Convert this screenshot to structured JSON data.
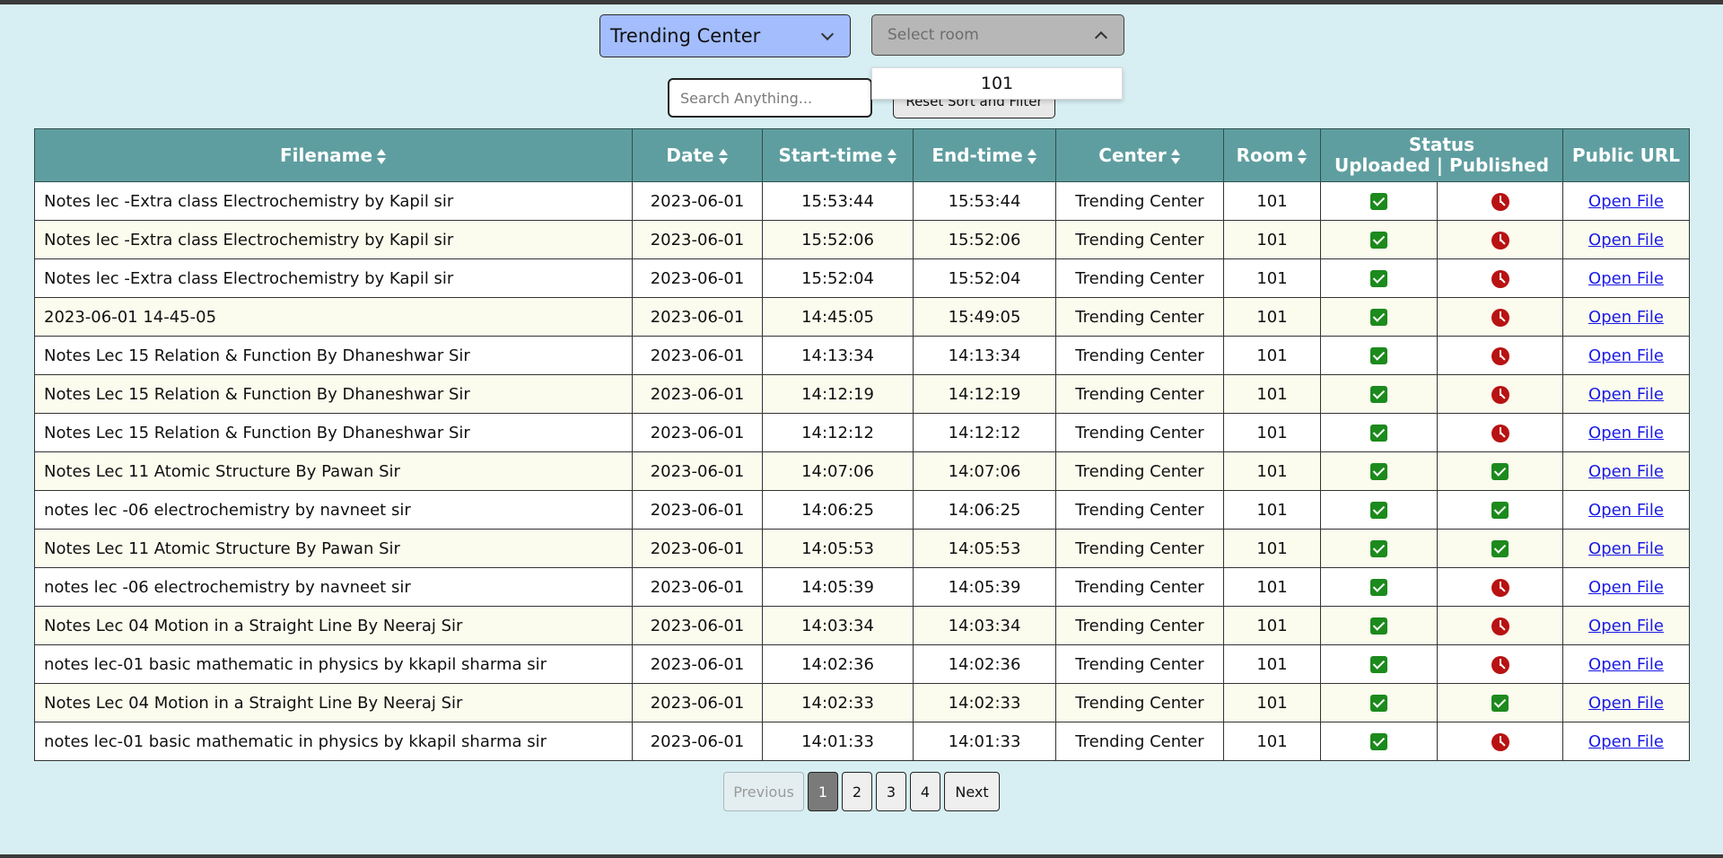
{
  "filters": {
    "center_select": "Trending Center",
    "room_select_placeholder": "Select room",
    "room_option": "101",
    "search_placeholder": "Search Anything...",
    "reset_label": "Reset Sort and Filter"
  },
  "table": {
    "headers": {
      "filename": "Filename",
      "date": "Date",
      "start": "Start-time",
      "end": "End-time",
      "center": "Center",
      "room": "Room",
      "status": "Status",
      "status_sub": "Uploaded | Published",
      "url": "Public URL"
    },
    "rows": [
      {
        "filename": "Notes lec -Extra class Electrochemistry by Kapil sir",
        "date": "2023-06-01",
        "start": "15:53:44",
        "end": "15:53:44",
        "center": "Trending Center",
        "room": "101",
        "uploaded": true,
        "published": false,
        "url": "Open File"
      },
      {
        "filename": "Notes lec -Extra class Electrochemistry by Kapil sir",
        "date": "2023-06-01",
        "start": "15:52:06",
        "end": "15:52:06",
        "center": "Trending Center",
        "room": "101",
        "uploaded": true,
        "published": false,
        "url": "Open File"
      },
      {
        "filename": "Notes lec -Extra class Electrochemistry by Kapil sir",
        "date": "2023-06-01",
        "start": "15:52:04",
        "end": "15:52:04",
        "center": "Trending Center",
        "room": "101",
        "uploaded": true,
        "published": false,
        "url": "Open File"
      },
      {
        "filename": "2023-06-01 14-45-05",
        "date": "2023-06-01",
        "start": "14:45:05",
        "end": "15:49:05",
        "center": "Trending Center",
        "room": "101",
        "uploaded": true,
        "published": false,
        "url": "Open File"
      },
      {
        "filename": "Notes Lec 15 Relation & Function By Dhaneshwar Sir",
        "date": "2023-06-01",
        "start": "14:13:34",
        "end": "14:13:34",
        "center": "Trending Center",
        "room": "101",
        "uploaded": true,
        "published": false,
        "url": "Open File"
      },
      {
        "filename": "Notes Lec 15 Relation & Function By Dhaneshwar Sir",
        "date": "2023-06-01",
        "start": "14:12:19",
        "end": "14:12:19",
        "center": "Trending Center",
        "room": "101",
        "uploaded": true,
        "published": false,
        "url": "Open File"
      },
      {
        "filename": "Notes Lec 15 Relation & Function By Dhaneshwar Sir",
        "date": "2023-06-01",
        "start": "14:12:12",
        "end": "14:12:12",
        "center": "Trending Center",
        "room": "101",
        "uploaded": true,
        "published": false,
        "url": "Open File"
      },
      {
        "filename": "Notes Lec 11 Atomic Structure By Pawan Sir",
        "date": "2023-06-01",
        "start": "14:07:06",
        "end": "14:07:06",
        "center": "Trending Center",
        "room": "101",
        "uploaded": true,
        "published": true,
        "url": "Open File"
      },
      {
        "filename": "notes lec -06 electrochemistry by navneet sir",
        "date": "2023-06-01",
        "start": "14:06:25",
        "end": "14:06:25",
        "center": "Trending Center",
        "room": "101",
        "uploaded": true,
        "published": true,
        "url": "Open File"
      },
      {
        "filename": "Notes Lec 11 Atomic Structure By Pawan Sir",
        "date": "2023-06-01",
        "start": "14:05:53",
        "end": "14:05:53",
        "center": "Trending Center",
        "room": "101",
        "uploaded": true,
        "published": true,
        "url": "Open File"
      },
      {
        "filename": "notes lec -06 electrochemistry by navneet sir",
        "date": "2023-06-01",
        "start": "14:05:39",
        "end": "14:05:39",
        "center": "Trending Center",
        "room": "101",
        "uploaded": true,
        "published": false,
        "url": "Open File"
      },
      {
        "filename": "Notes Lec 04 Motion in a Straight Line By Neeraj Sir",
        "date": "2023-06-01",
        "start": "14:03:34",
        "end": "14:03:34",
        "center": "Trending Center",
        "room": "101",
        "uploaded": true,
        "published": false,
        "url": "Open File"
      },
      {
        "filename": "notes lec-01 basic mathematic in physics by kkapil sharma sir",
        "date": "2023-06-01",
        "start": "14:02:36",
        "end": "14:02:36",
        "center": "Trending Center",
        "room": "101",
        "uploaded": true,
        "published": false,
        "url": "Open File"
      },
      {
        "filename": "Notes Lec 04 Motion in a Straight Line By Neeraj Sir",
        "date": "2023-06-01",
        "start": "14:02:33",
        "end": "14:02:33",
        "center": "Trending Center",
        "room": "101",
        "uploaded": true,
        "published": true,
        "url": "Open File"
      },
      {
        "filename": "notes lec-01 basic mathematic in physics by kkapil sharma sir",
        "date": "2023-06-01",
        "start": "14:01:33",
        "end": "14:01:33",
        "center": "Trending Center",
        "room": "101",
        "uploaded": true,
        "published": false,
        "url": "Open File"
      }
    ]
  },
  "pagination": {
    "prev": "Previous",
    "next": "Next",
    "pages": [
      "1",
      "2",
      "3",
      "4"
    ],
    "current": "1"
  },
  "colors": {
    "background": "#d7eff3",
    "header": "#5f9ea0",
    "uploaded": "#1c8a1c",
    "pending": "#b81212",
    "center_select": "#a3bdfd"
  },
  "icons": {
    "check": "check-icon",
    "pending": "clock-icon",
    "chevron": "chevron-icon"
  }
}
